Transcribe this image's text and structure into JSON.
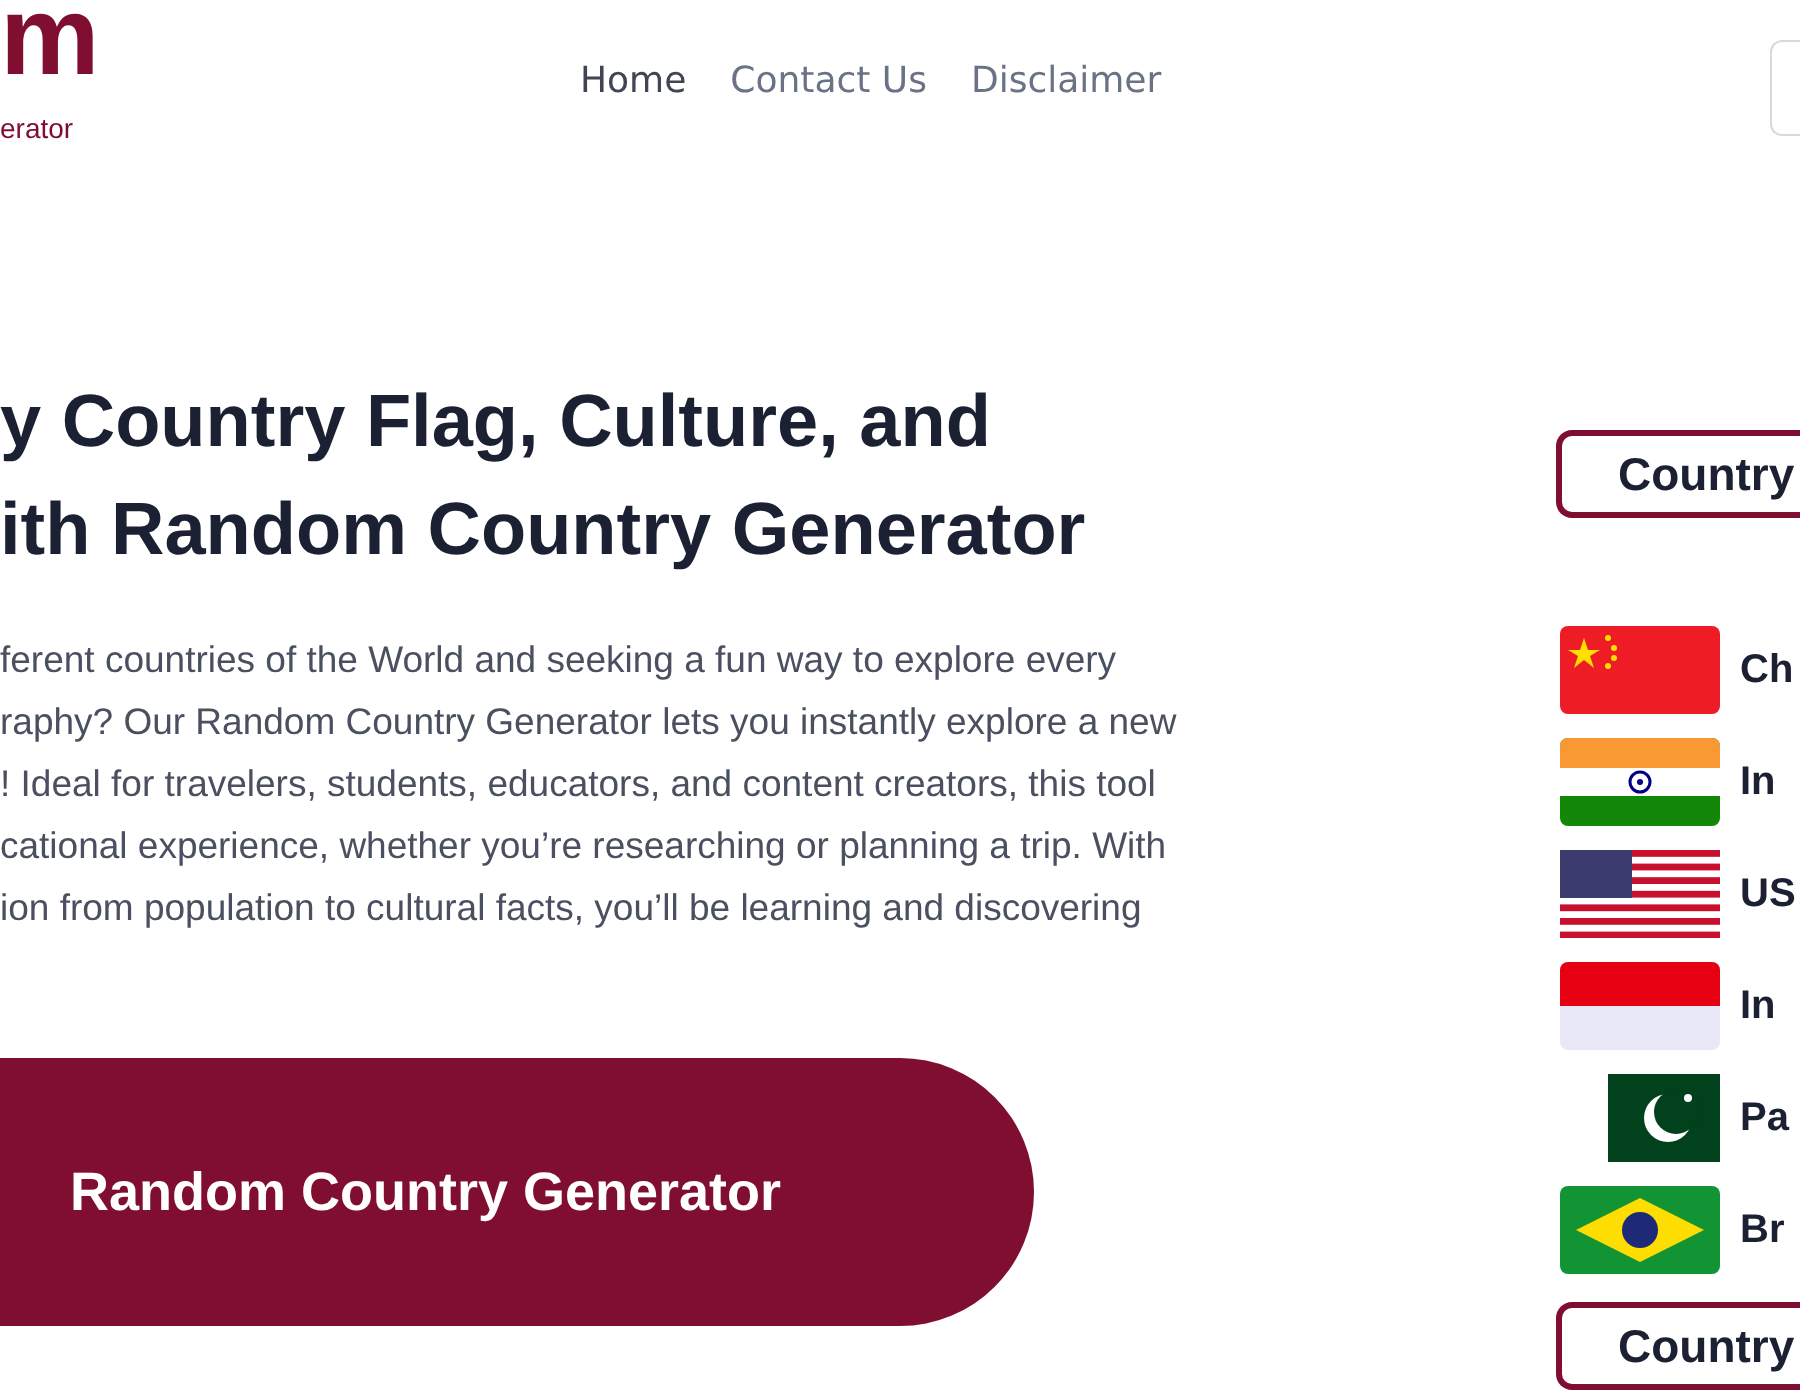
{
  "logo": {
    "mark": "m",
    "tagline": "erator"
  },
  "nav": [
    {
      "label": "Home",
      "selected": true
    },
    {
      "label": "Contact Us",
      "selected": false
    },
    {
      "label": "Disclaimer",
      "selected": false
    }
  ],
  "heading_lines": [
    "y Country Flag, Culture, and",
    "ith Random Country Generator"
  ],
  "intro": "ferent countries of the World and seeking a fun way to explore every\nraphy? Our Random Country Generator lets you instantly explore a new\n! Ideal for travelers, students, educators, and content creators, this tool\ncational experience, whether you’re researching or planning a trip. With\nion from population to cultural facts, you’ll be learning and discovering",
  "generate_button": "Random Country Generator",
  "sidebar": {
    "title": "Country",
    "countries": [
      {
        "name": "Ch",
        "kind": "china"
      },
      {
        "name": "In",
        "kind": "india"
      },
      {
        "name": "US",
        "kind": "usa"
      },
      {
        "name": "In",
        "kind": "indonesia"
      },
      {
        "name": "Pa",
        "kind": "pakistan"
      },
      {
        "name": "Br",
        "kind": "brazil"
      }
    ],
    "next_title": "Country"
  }
}
